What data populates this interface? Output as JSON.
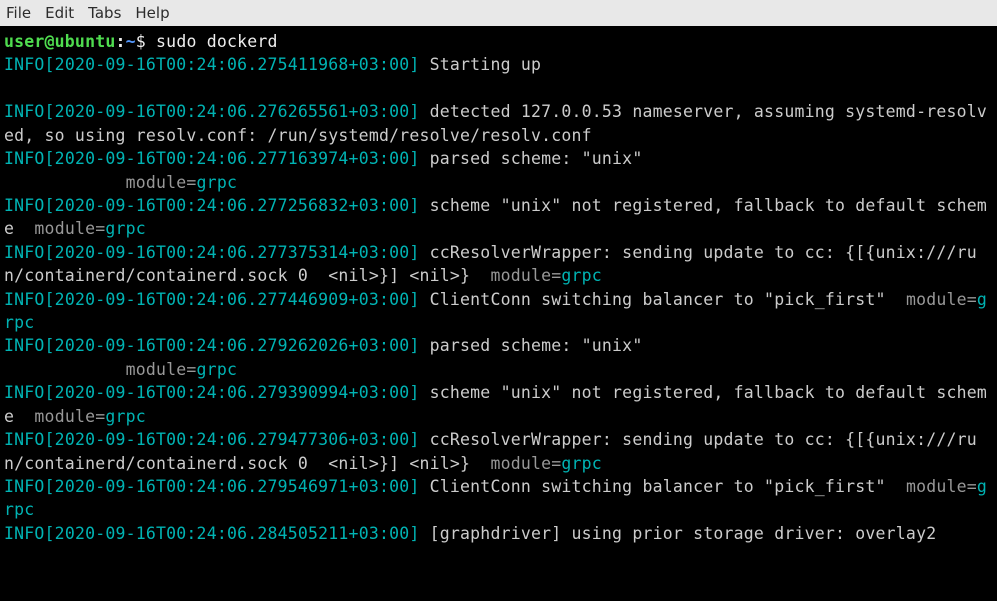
{
  "menubar": {
    "items": [
      "File",
      "Edit",
      "Tabs",
      "Help"
    ]
  },
  "prompt": {
    "user_host": "user@ubuntu",
    "separator": ":",
    "path": "~",
    "symbol": "$",
    "command": "sudo dockerd"
  },
  "log": {
    "level_label": "INFO",
    "module_key": "module=",
    "module_val": "grpc",
    "entries": [
      {
        "ts": "2020-09-16T00:24:06.275411968+03:00",
        "msg": "Starting up",
        "module": false,
        "leading_module": false,
        "trailing_blank": true
      },
      {
        "ts": "2020-09-16T00:24:06.276265561+03:00",
        "msg": "detected 127.0.0.53 nameserver, assuming systemd-resolved, so using resolv.conf: /run/systemd/resolve/resolv.conf",
        "module": false,
        "leading_module": false
      },
      {
        "ts": "2020-09-16T00:24:06.277163974+03:00",
        "msg": "parsed scheme: \"unix\"",
        "module": false,
        "leading_module": true
      },
      {
        "ts": "2020-09-16T00:24:06.277256832+03:00",
        "msg": "scheme \"unix\" not registered, fallback to default scheme",
        "module": true,
        "leading_module": false
      },
      {
        "ts": "2020-09-16T00:24:06.277375314+03:00",
        "msg": "ccResolverWrapper: sending update to cc: {[{unix:///run/containerd/containerd.sock 0  <nil>}] <nil>}",
        "module": true,
        "leading_module": false
      },
      {
        "ts": "2020-09-16T00:24:06.277446909+03:00",
        "msg": "ClientConn switching balancer to \"pick_first\"",
        "module": true,
        "leading_module": false
      },
      {
        "ts": "2020-09-16T00:24:06.279262026+03:00",
        "msg": "parsed scheme: \"unix\"",
        "module": false,
        "leading_module": true
      },
      {
        "ts": "2020-09-16T00:24:06.279390994+03:00",
        "msg": "scheme \"unix\" not registered, fallback to default scheme",
        "module": true,
        "leading_module": false
      },
      {
        "ts": "2020-09-16T00:24:06.279477306+03:00",
        "msg": "ccResolverWrapper: sending update to cc: {[{unix:///run/containerd/containerd.sock 0  <nil>}] <nil>}",
        "module": true,
        "leading_module": false
      },
      {
        "ts": "2020-09-16T00:24:06.279546971+03:00",
        "msg": "ClientConn switching balancer to \"pick_first\"",
        "module": true,
        "leading_module": false
      },
      {
        "ts": "2020-09-16T00:24:06.284505211+03:00",
        "msg": "[graphdriver] using prior storage driver: overlay2",
        "module": false,
        "leading_module": false
      }
    ]
  }
}
